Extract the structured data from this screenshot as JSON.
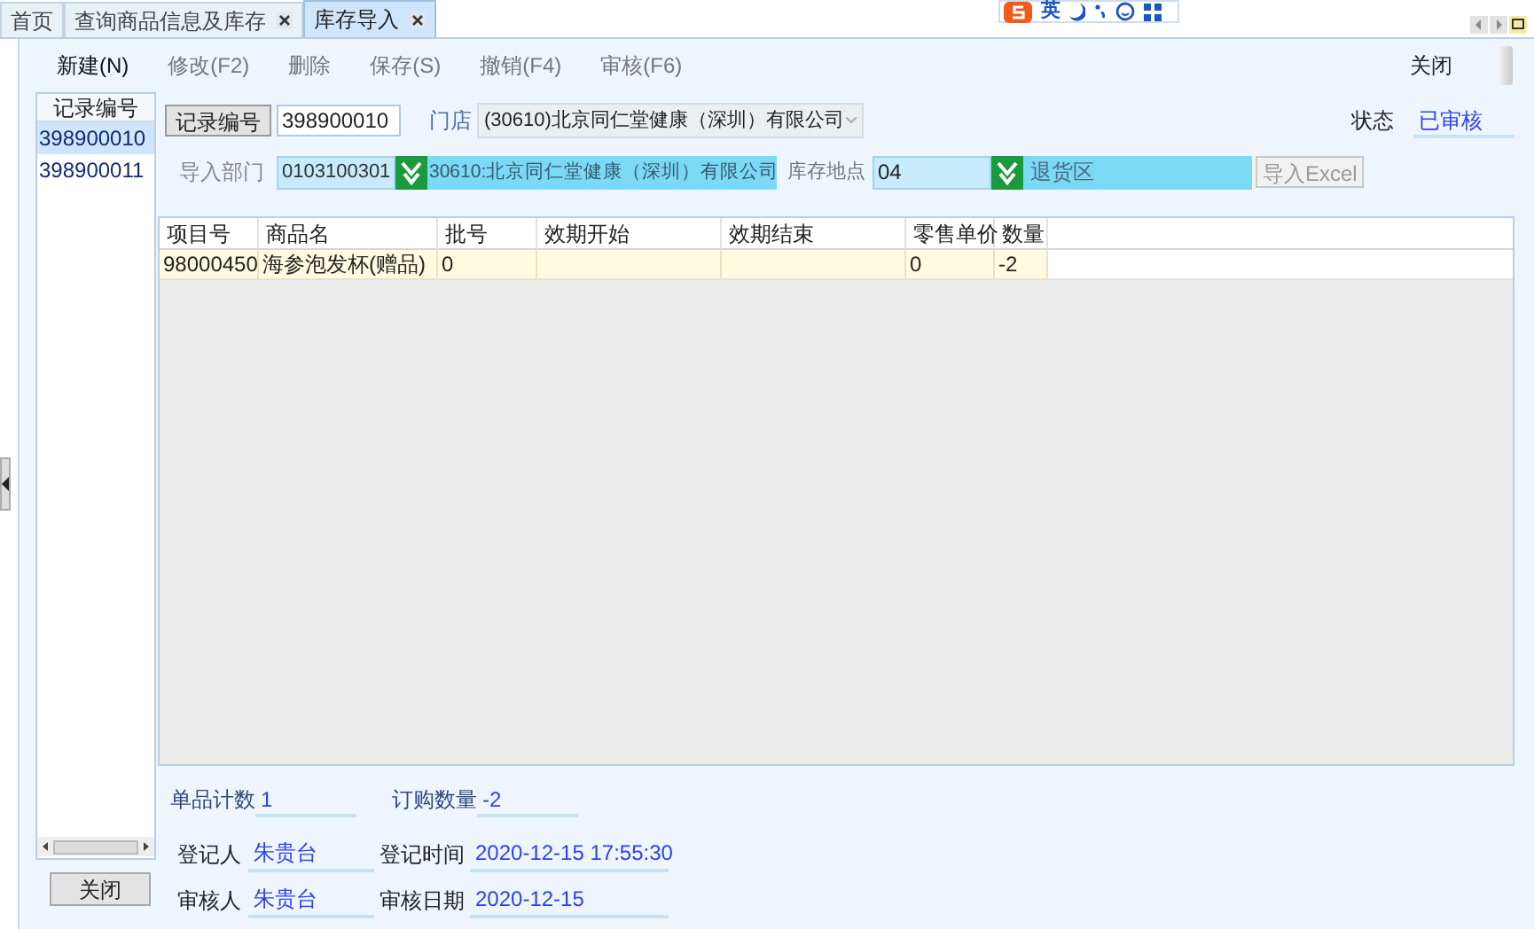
{
  "tabs": [
    {
      "label": "首页",
      "closable": false,
      "selected": false
    },
    {
      "label": "查询商品信息及库存",
      "closable": true,
      "selected": false
    },
    {
      "label": "库存导入",
      "closable": true,
      "selected": true
    }
  ],
  "ime_toolbar": {
    "label": "英"
  },
  "toolbar": [
    {
      "label": "新建(N)",
      "disabled": false
    },
    {
      "label": "修改(F2)",
      "disabled": true
    },
    {
      "label": "删除",
      "disabled": true
    },
    {
      "label": "保存(S)",
      "disabled": true
    },
    {
      "label": "撤销(F4)",
      "disabled": true
    },
    {
      "label": "审核(F6)",
      "disabled": true
    }
  ],
  "toolbar_close": "关闭",
  "record_list": {
    "header": "记录编号",
    "items": [
      {
        "label": "398900010",
        "selected": true
      },
      {
        "label": "398900011",
        "selected": false
      }
    ]
  },
  "close_button": "关闭",
  "form": {
    "record_no_button": "记录编号",
    "record_no": "398900010",
    "store_label": "门店",
    "store_value": "(30610)北京同仁堂健康（深圳）有限公司",
    "status_label": "状态",
    "status_value": "已审核",
    "dept_label": "导入部门",
    "dept_code": "0103100301",
    "dept_name": "30610:北京同仁堂健康（深圳）有限公司",
    "location_label": "库存地点",
    "location_code": "04",
    "location_name": "退货区",
    "import_button": "导入Excel"
  },
  "table": {
    "columns": [
      "项目号",
      "商品名",
      "批号",
      "效期开始",
      "效期结束",
      "零售单价",
      "数量"
    ],
    "rows": [
      {
        "cells": [
          "98000450",
          "海参泡发杯(赠品)",
          "0",
          null,
          null,
          "0",
          "-2"
        ]
      }
    ]
  },
  "summary": [
    {
      "label": "单品计数",
      "value": "1"
    },
    {
      "label": "订购数量",
      "value": "-2"
    }
  ],
  "signoff": [
    {
      "label": "登记人",
      "value": "朱贵台",
      "time_label": "登记时间",
      "time_value": "2020-12-15 17:55:30"
    },
    {
      "label": "审核人",
      "value": "朱贵台",
      "time_label": "审核日期",
      "time_value": "2020-12-15"
    }
  ]
}
